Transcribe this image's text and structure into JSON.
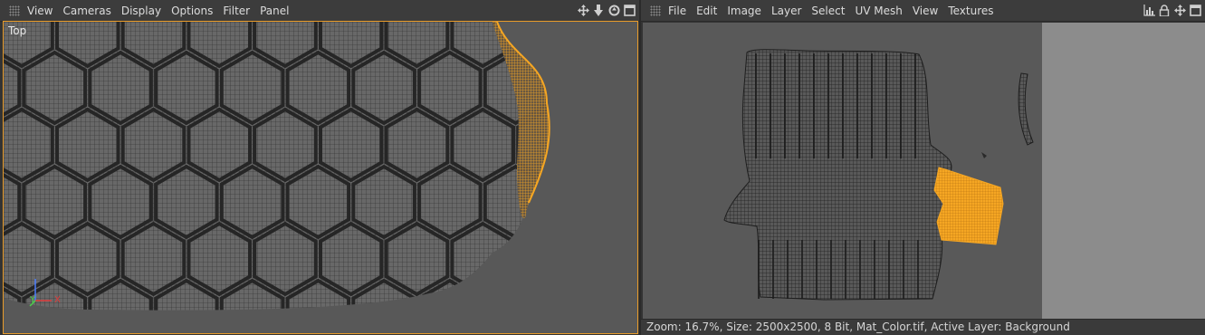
{
  "left_panel": {
    "menu": [
      "View",
      "Cameras",
      "Display",
      "Options",
      "Filter",
      "Panel"
    ],
    "viewport_label": "Top",
    "axis_labels": {
      "x": "X",
      "y": "Y"
    },
    "icons": [
      "move-icon",
      "down-arrow-icon",
      "rotate-icon",
      "maximize-icon"
    ]
  },
  "right_panel": {
    "menu": [
      "File",
      "Edit",
      "Image",
      "Layer",
      "Select",
      "UV Mesh",
      "View",
      "Textures"
    ],
    "icons": [
      "histogram-icon",
      "lock-icon",
      "move-icon",
      "maximize-icon"
    ],
    "status": "Zoom: 16.7%, Size: 2500x2500, 8 Bit, Mat_Color.tif, Active Layer: Background"
  },
  "colors": {
    "accent": "#f5a623",
    "viewport_bg": "#585858",
    "mesh": "#2a2a2a",
    "panel": "#3c3c3c"
  }
}
